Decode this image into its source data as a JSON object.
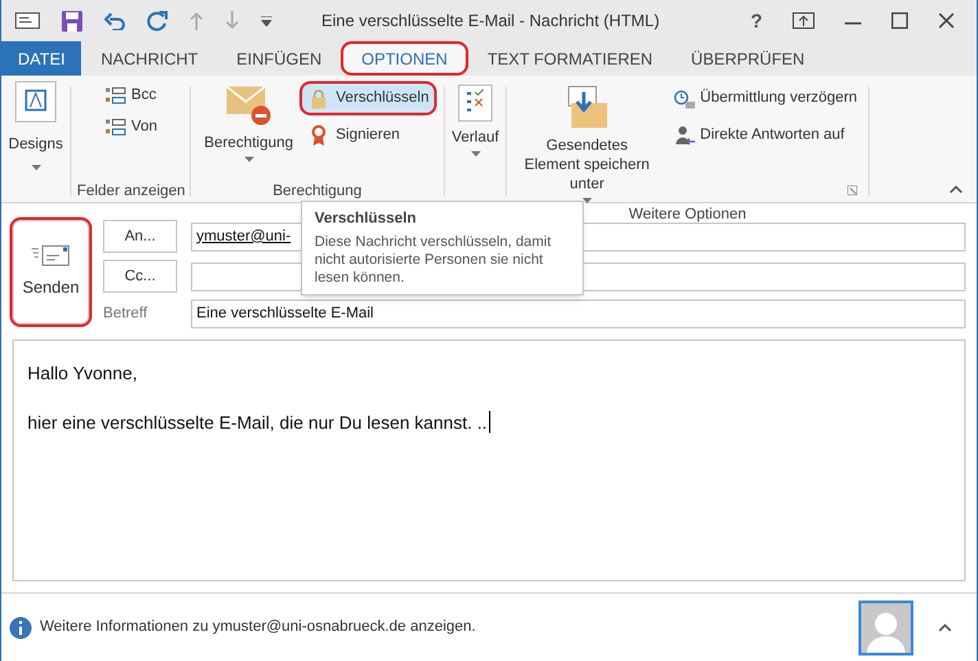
{
  "window": {
    "title": "Eine verschlüsselte E-Mail - Nachricht (HTML)",
    "help": "?"
  },
  "tabs": [
    {
      "label": "DATEI",
      "kind": "file",
      "selected": false,
      "highlighted": false
    },
    {
      "label": "NACHRICHT",
      "kind": "tab",
      "selected": false,
      "highlighted": false
    },
    {
      "label": "EINFÜGEN",
      "kind": "tab",
      "selected": false,
      "highlighted": false
    },
    {
      "label": "OPTIONEN",
      "kind": "tab",
      "selected": true,
      "highlighted": true
    },
    {
      "label": "TEXT FORMATIEREN",
      "kind": "tab",
      "selected": false,
      "highlighted": false
    },
    {
      "label": "ÜBERPRÜFEN",
      "kind": "tab",
      "selected": false,
      "highlighted": false
    }
  ],
  "ribbon": {
    "designs": "Designs",
    "groups": [
      {
        "label": "Felder anzeigen",
        "items": [
          {
            "label": "Bcc",
            "kind": "small"
          },
          {
            "label": "Von",
            "kind": "small"
          }
        ]
      },
      {
        "label": "Berechtigung",
        "items": [
          {
            "label": "Berechtigung",
            "kind": "large"
          },
          {
            "label": "Verschlüsseln",
            "kind": "small",
            "selected": true,
            "highlighted": true
          },
          {
            "label": "Signieren",
            "kind": "small",
            "selected": false,
            "highlighted": false
          }
        ]
      },
      {
        "items": [
          {
            "label": "Verlauf",
            "kind": "large"
          }
        ]
      },
      {
        "label": "Weitere Optionen",
        "items": [
          {
            "label": "Gesendetes Element speichern unter",
            "kind": "large"
          },
          {
            "label": "Übermittlung verzögern",
            "kind": "small"
          },
          {
            "label": "Direkte Antworten auf",
            "kind": "small"
          }
        ]
      }
    ]
  },
  "compose": {
    "send": {
      "label": "Senden",
      "highlighted": true
    },
    "fields": [
      {
        "button": "An...",
        "value": "ymuster@uni-"
      },
      {
        "button": "Cc..."
      }
    ],
    "subject_label": "Betreff",
    "subject": "Eine verschlüsselte E-Mail",
    "body": [
      "Hallo Yvonne,",
      "hier eine verschlüsselte E-Mail, die nur Du lesen kannst. .."
    ]
  },
  "tooltip": {
    "title": "Verschlüsseln",
    "text": "Diese Nachricht verschlüsseln, damit nicht autorisierte Personen sie nicht lesen können."
  },
  "status_bar": {
    "text": "Weitere Informationen zu ymuster@uni-osnabrueck.de anzeigen."
  }
}
